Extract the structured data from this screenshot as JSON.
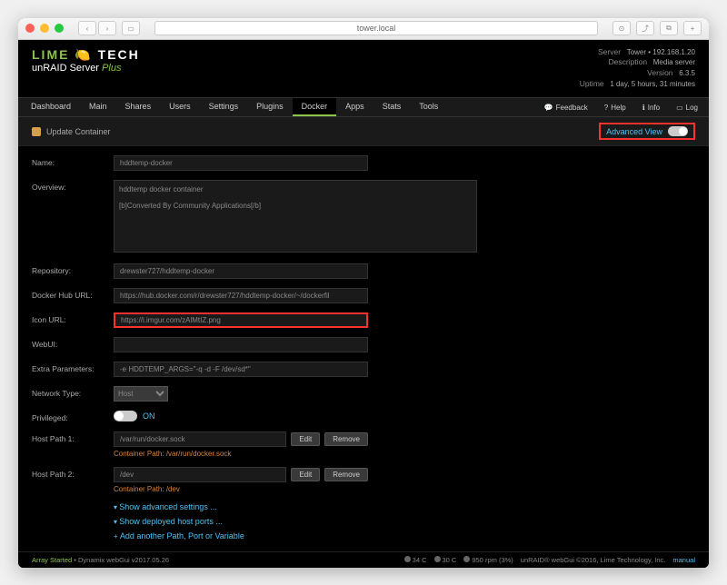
{
  "browser": {
    "url": "tower.local"
  },
  "logo": {
    "lime": "LIME",
    "tech": "TECH",
    "sub1": "unRAID Server",
    "sub2": "Plus"
  },
  "serverInfo": {
    "server_label": "Server",
    "server_value": "Tower • 192.168.1.20",
    "desc_label": "Description",
    "desc_value": "Media server",
    "version_label": "Version",
    "version_value": "6.3.5",
    "uptime_label": "Uptime",
    "uptime_value": "1 day, 5 hours, 31 minutes"
  },
  "tabs": [
    "Dashboard",
    "Main",
    "Shares",
    "Users",
    "Settings",
    "Plugins",
    "Docker",
    "Apps",
    "Stats",
    "Tools"
  ],
  "tabRight": {
    "feedback": "Feedback",
    "help": "Help",
    "info": "Info",
    "log": "Log"
  },
  "subheader": {
    "title": "Update Container",
    "advanced": "Advanced View"
  },
  "form": {
    "name_label": "Name:",
    "name_value": "hddtemp-docker",
    "overview_label": "Overview:",
    "overview_value": "hddtemp docker container\n\n[b]Converted By Community Applications[/b]",
    "repo_label": "Repository:",
    "repo_value": "drewster727/hddtemp-docker",
    "hub_label": "Docker Hub URL:",
    "hub_value": "https://hub.docker.com/r/drewster727/hddtemp-docker/~/dockerfil",
    "icon_label": "Icon URL:",
    "icon_value": "https://i.imgur.com/zAlMtIZ.png",
    "webui_label": "WebUI:",
    "webui_value": "",
    "extra_label": "Extra Parameters:",
    "extra_value": "-e HDDTEMP_ARGS=\"-q -d -F /dev/sd*\"",
    "network_label": "Network Type:",
    "network_value": "Host",
    "priv_label": "Privileged:",
    "priv_on": "ON",
    "host1_label": "Host Path 1:",
    "host1_value": "/var/run/docker.sock",
    "host1_path": "Container Path: /var/run/docker.sock",
    "host2_label": "Host Path 2:",
    "host2_value": "/dev",
    "host2_path": "Container Path: /dev",
    "edit": "Edit",
    "remove": "Remove",
    "show_adv": "Show advanced settings ...",
    "show_ports": "Show deployed host ports ...",
    "add_path": "Add another Path, Port or Variable"
  },
  "footer": {
    "array": "Array Started",
    "dynamix": " • Dynamix webGui v2017.05.26",
    "temp1": "34 C",
    "temp2": "30 C",
    "rpm": "950 rpm (3%)",
    "copyright": "unRAID® webGui ©2016, Lime Technology, Inc.",
    "manual": "manual"
  }
}
